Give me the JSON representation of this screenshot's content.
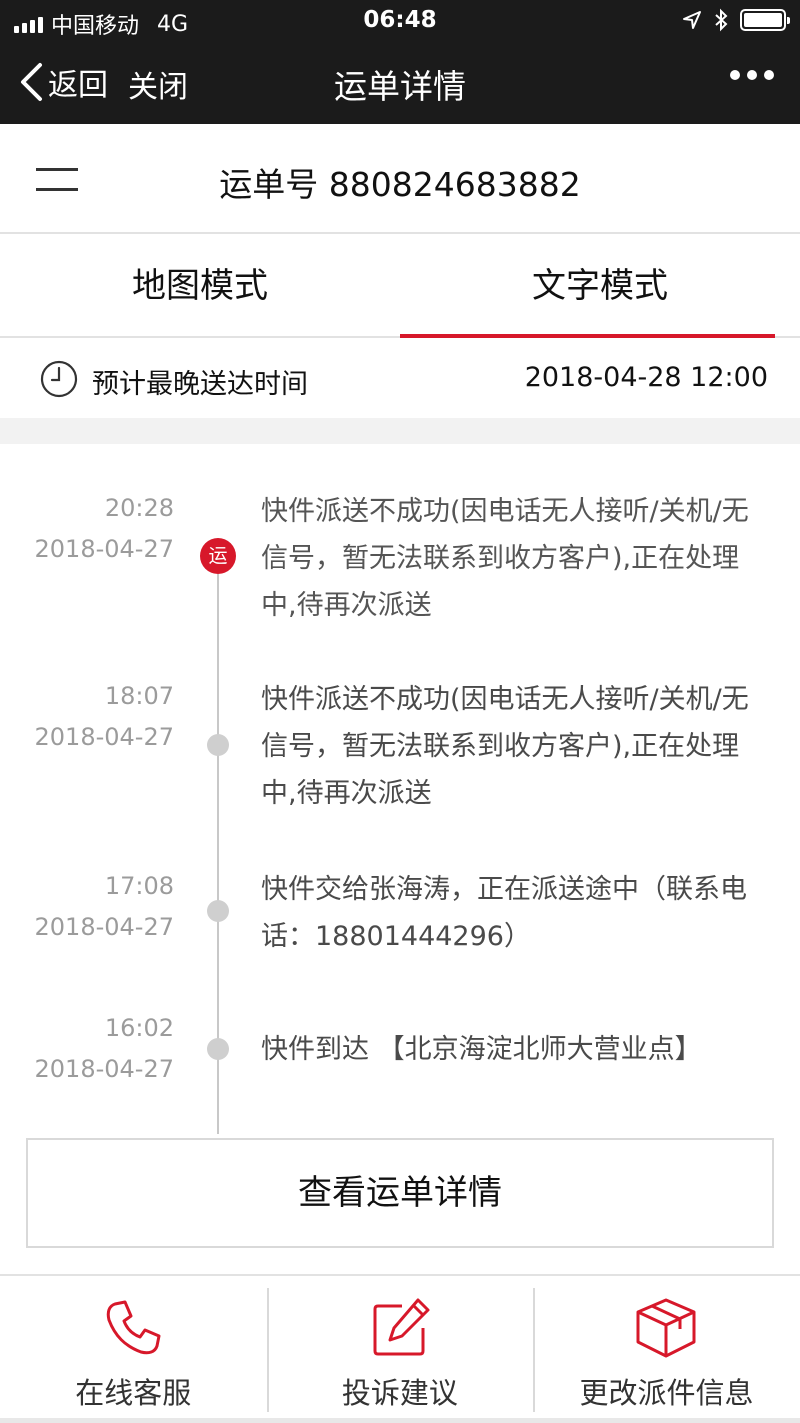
{
  "status_bar": {
    "carrier": "中国移动",
    "network": "4G",
    "time": "06:48",
    "battery_level": 1.0
  },
  "nav": {
    "back_label": "返回",
    "close_label": "关闭",
    "title": "运单详情",
    "more_icon": "more-dots-icon"
  },
  "waybill": {
    "number_text": "运单号 880824683882"
  },
  "tabs": [
    {
      "label": "地图模式",
      "active": false
    },
    {
      "label": "文字模式",
      "active": true
    }
  ],
  "eta": {
    "label": "预计最晚送达时间",
    "value": "2018-04-28 12:00"
  },
  "timeline": {
    "badge_label": "运",
    "events": [
      {
        "time": "20:28",
        "date": "2018-04-27",
        "description": "快件派送不成功(因电话无人接听/关机/无信号，暂无法联系到收方客户),正在处理中,待再次派送"
      },
      {
        "time": "18:07",
        "date": "2018-04-27",
        "description": "快件派送不成功(因电话无人接听/关机/无信号，暂无法联系到收方客户),正在处理中,待再次派送"
      },
      {
        "time": "17:08",
        "date": "2018-04-27",
        "description": "快件交给张海涛，正在派送途中（联系电话：18801444296）"
      },
      {
        "time": "16:02",
        "date": "2018-04-27",
        "description": "快件到达 【北京海淀北师大营业点】"
      }
    ]
  },
  "detail_button": {
    "label": "查看运单详情"
  },
  "bottom_bar": [
    {
      "label": "在线客服",
      "icon": "phone-icon"
    },
    {
      "label": "投诉建议",
      "icon": "edit-icon"
    },
    {
      "label": "更改派件信息",
      "icon": "package-icon"
    }
  ],
  "colors": {
    "accent": "#d7182a",
    "header_bg": "#1b1b1b",
    "timeline_dot": "#cfcfcf",
    "muted_text": "#9b9b9b"
  }
}
